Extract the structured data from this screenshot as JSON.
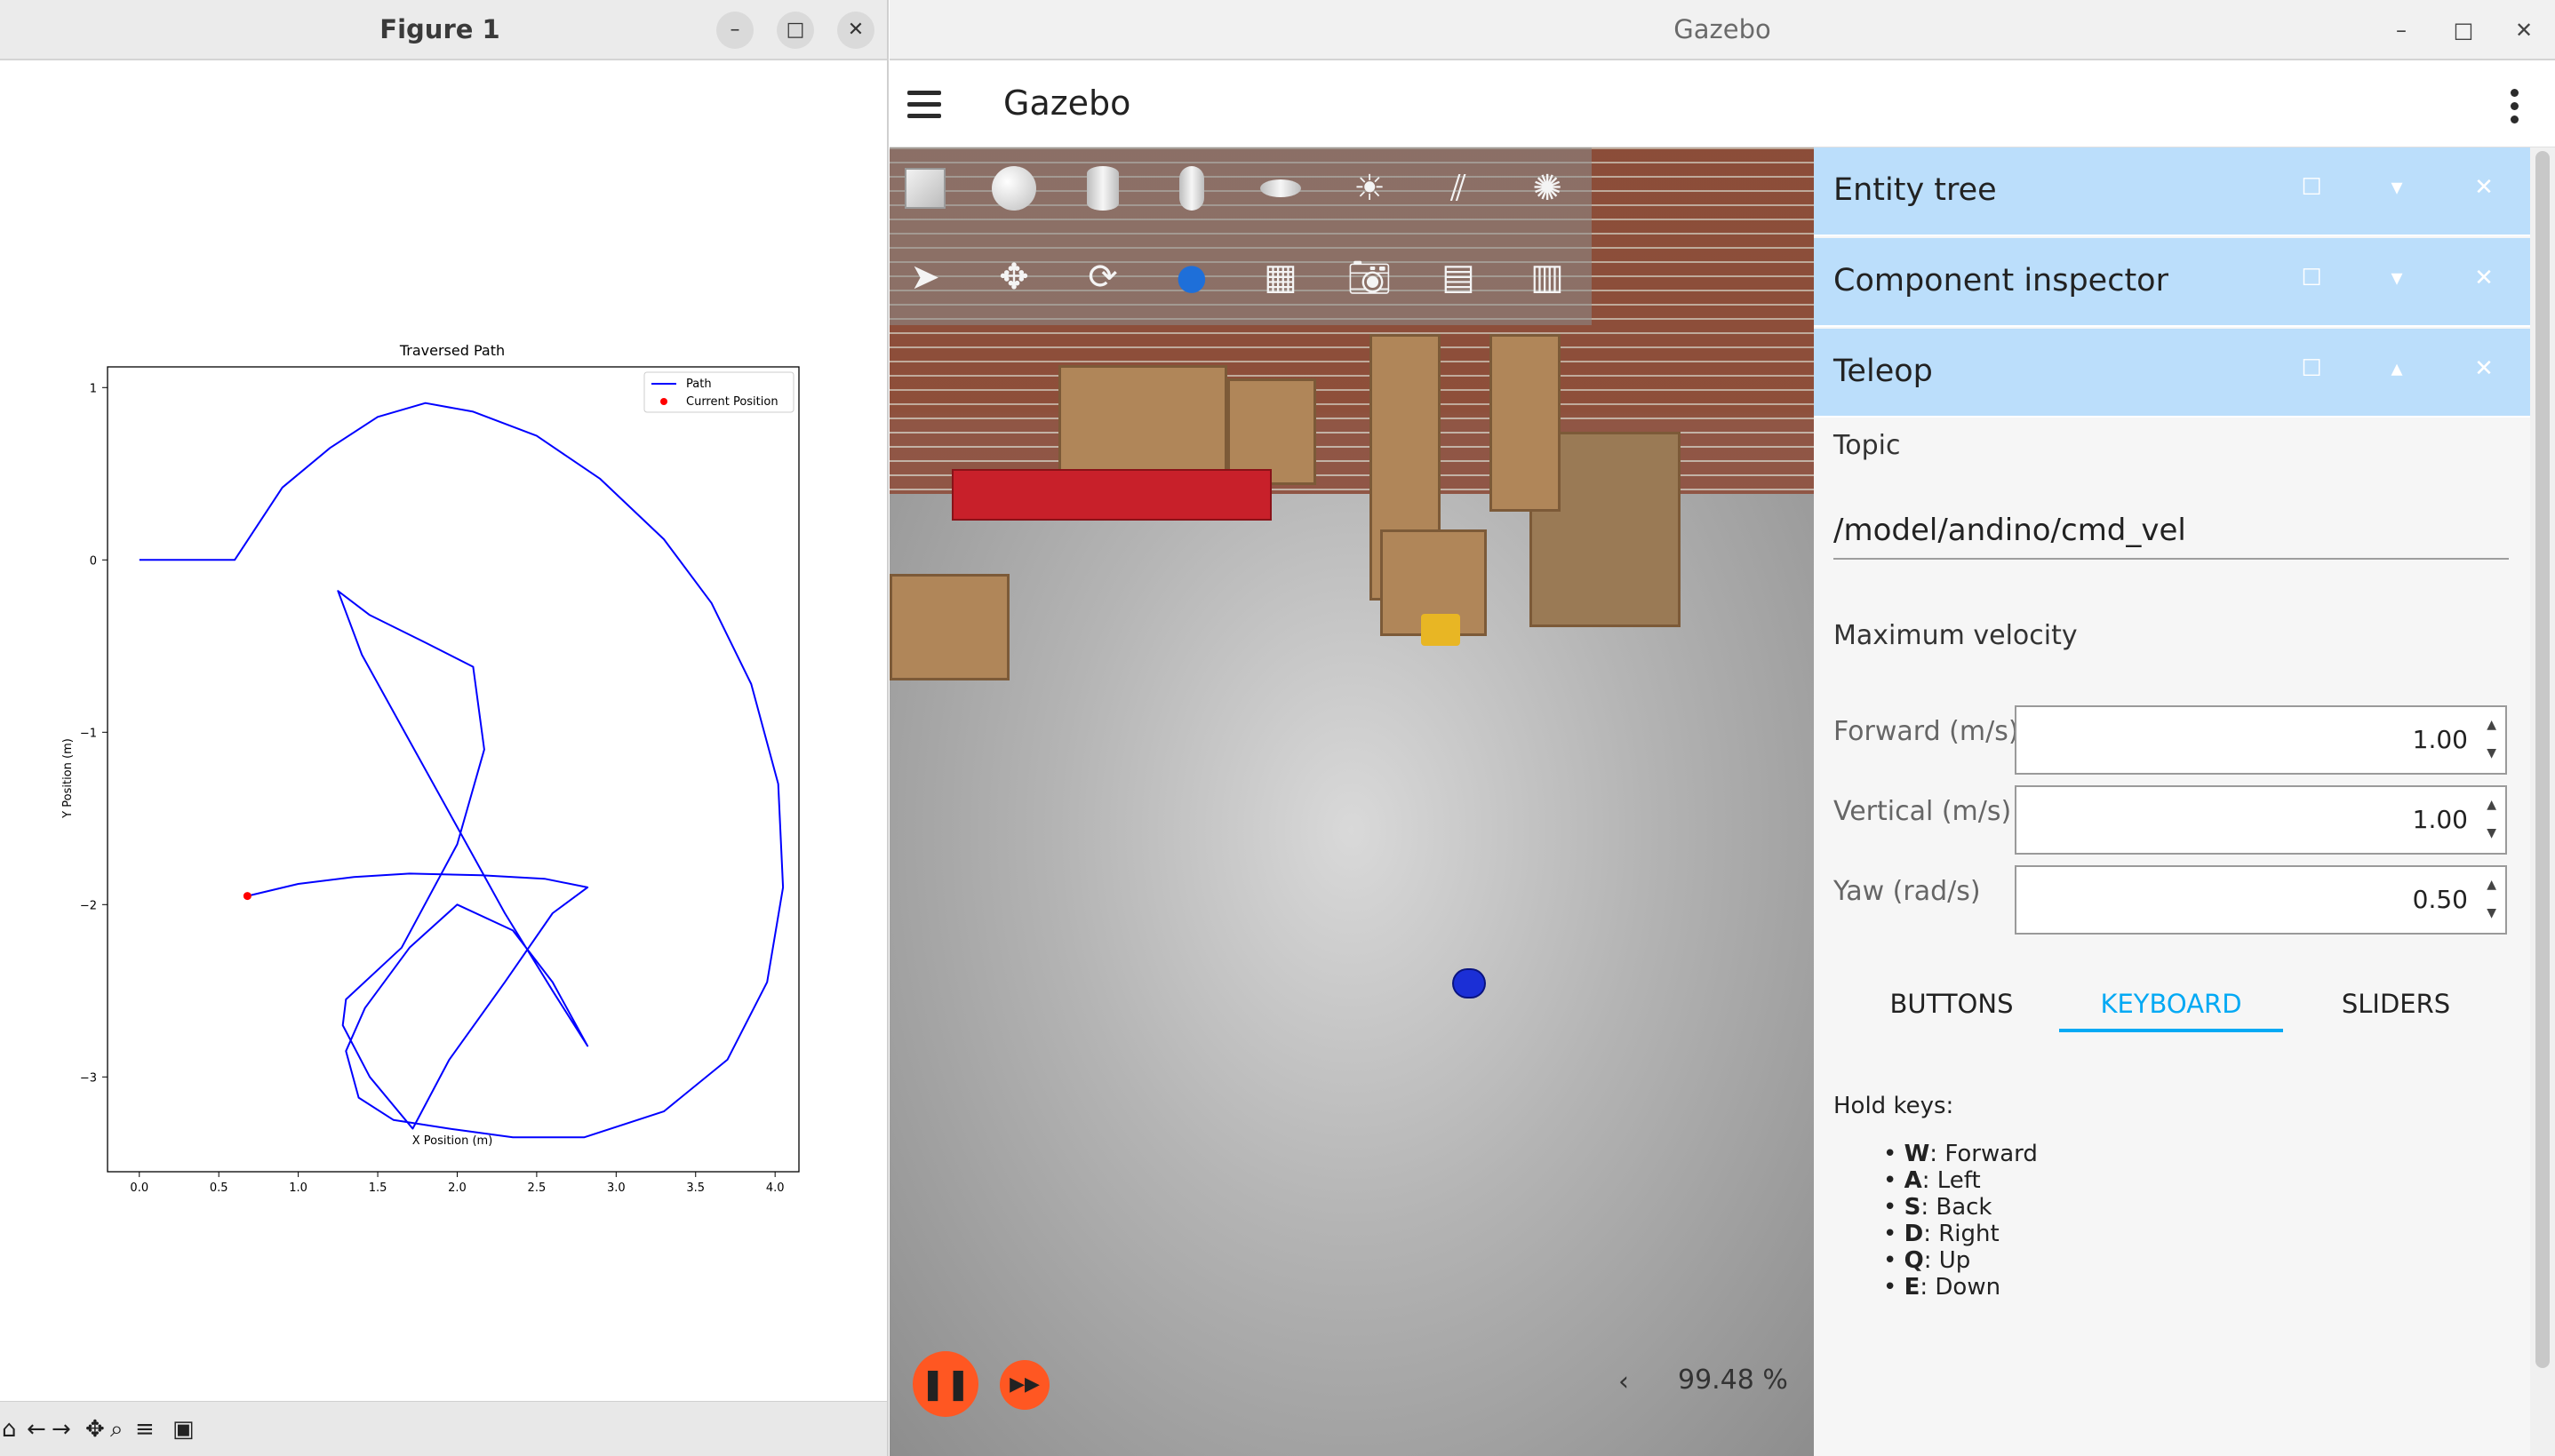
{
  "figure_window": {
    "title": "Figure 1",
    "toolbar_icons": [
      "home-icon",
      "back-icon",
      "forward-icon",
      "pan-icon",
      "zoom-icon",
      "configure-icon",
      "save-icon"
    ]
  },
  "chart_data": {
    "type": "line",
    "title": "Traversed Path",
    "xlabel": "X Position (m)",
    "ylabel": "Y Position (m)",
    "xlim": [
      -0.2,
      4.15
    ],
    "ylim": [
      -3.55,
      1.12
    ],
    "xticks": [
      "0.0",
      "0.5",
      "1.0",
      "1.5",
      "2.0",
      "2.5",
      "3.0",
      "3.5",
      "4.0"
    ],
    "xtick_values": [
      0,
      0.5,
      1,
      1.5,
      2,
      2.5,
      3,
      3.5,
      4
    ],
    "yticks": [
      "1",
      "0",
      "−1",
      "−2",
      "−3"
    ],
    "ytick_values": [
      1,
      0,
      -1,
      -2,
      -3
    ],
    "legend_position": "top-right",
    "grid": false,
    "series": [
      {
        "name": "Path",
        "color": "#0000ff",
        "x": [
          0.0,
          0.6,
          0.9,
          1.2,
          1.5,
          1.8,
          2.1,
          2.5,
          2.9,
          3.3,
          3.6,
          3.85,
          4.02,
          4.05,
          3.95,
          3.7,
          3.3,
          2.8,
          2.35,
          1.95,
          1.6,
          1.38,
          1.3,
          1.42,
          1.7,
          2.0,
          2.35,
          2.6,
          2.82,
          2.6,
          2.3,
          2.0,
          1.7,
          1.4,
          1.25,
          1.45,
          1.8,
          2.1,
          2.17,
          2.0,
          1.65,
          1.3,
          1.28,
          1.45,
          1.72,
          1.95,
          2.3,
          2.6,
          2.82,
          2.55,
          2.15,
          1.7,
          1.35,
          1.0,
          0.68
        ],
        "y": [
          0.0,
          0.0,
          0.42,
          0.65,
          0.83,
          0.91,
          0.86,
          0.72,
          0.47,
          0.12,
          -0.25,
          -0.72,
          -1.3,
          -1.9,
          -2.45,
          -2.9,
          -3.2,
          -3.35,
          -3.35,
          -3.3,
          -3.25,
          -3.12,
          -2.85,
          -2.6,
          -2.25,
          -2.0,
          -2.15,
          -2.45,
          -2.82,
          -2.5,
          -2.05,
          -1.55,
          -1.05,
          -0.55,
          -0.18,
          -0.32,
          -0.48,
          -0.62,
          -1.1,
          -1.65,
          -2.25,
          -2.55,
          -2.7,
          -3.0,
          -3.3,
          -2.9,
          -2.45,
          -2.05,
          -1.9,
          -1.85,
          -1.83,
          -1.82,
          -1.84,
          -1.88,
          -1.95
        ]
      },
      {
        "name": "Current Position",
        "color": "#ff0000",
        "marker": "dot",
        "x": [
          0.68
        ],
        "y": [
          -1.95
        ]
      }
    ]
  },
  "gazebo_window": {
    "title": "Gazebo",
    "app_title": "Gazebo",
    "shape_tools": [
      "box-icon",
      "sphere-icon",
      "cylinder-icon",
      "capsule-icon",
      "ellipsoid-icon",
      "sun-light-icon",
      "directional-light-icon",
      "spot-light-icon"
    ],
    "transform_tools": [
      "select-arrow-icon",
      "translate-icon",
      "rotate-icon",
      "mesh-icon",
      "grid-icon",
      "camera-icon",
      "copy-icon",
      "paste-icon"
    ],
    "real_time_factor": "99.48 %",
    "docks": {
      "entity_tree": "Entity tree",
      "component_inspector": "Component inspector",
      "teleop": "Teleop"
    },
    "teleop": {
      "topic_label": "Topic",
      "topic_value": "/model/andino/cmd_vel",
      "max_velocity_label": "Maximum velocity",
      "forward_label": "Forward (m/s)",
      "forward_value": "1.00",
      "vertical_label": "Vertical (m/s)",
      "vertical_value": "1.00",
      "yaw_label": "Yaw (rad/s)",
      "yaw_value": "0.50",
      "tabs": [
        "BUTTONS",
        "KEYBOARD",
        "SLIDERS"
      ],
      "active_tab": "KEYBOARD",
      "hold_keys_label": "Hold keys:",
      "keys": [
        {
          "key": "W",
          "action": ": Forward"
        },
        {
          "key": "A",
          "action": ": Left"
        },
        {
          "key": "S",
          "action": ": Back"
        },
        {
          "key": "D",
          "action": ": Right"
        },
        {
          "key": "Q",
          "action": ": Up"
        },
        {
          "key": "E",
          "action": ": Down"
        }
      ]
    }
  }
}
